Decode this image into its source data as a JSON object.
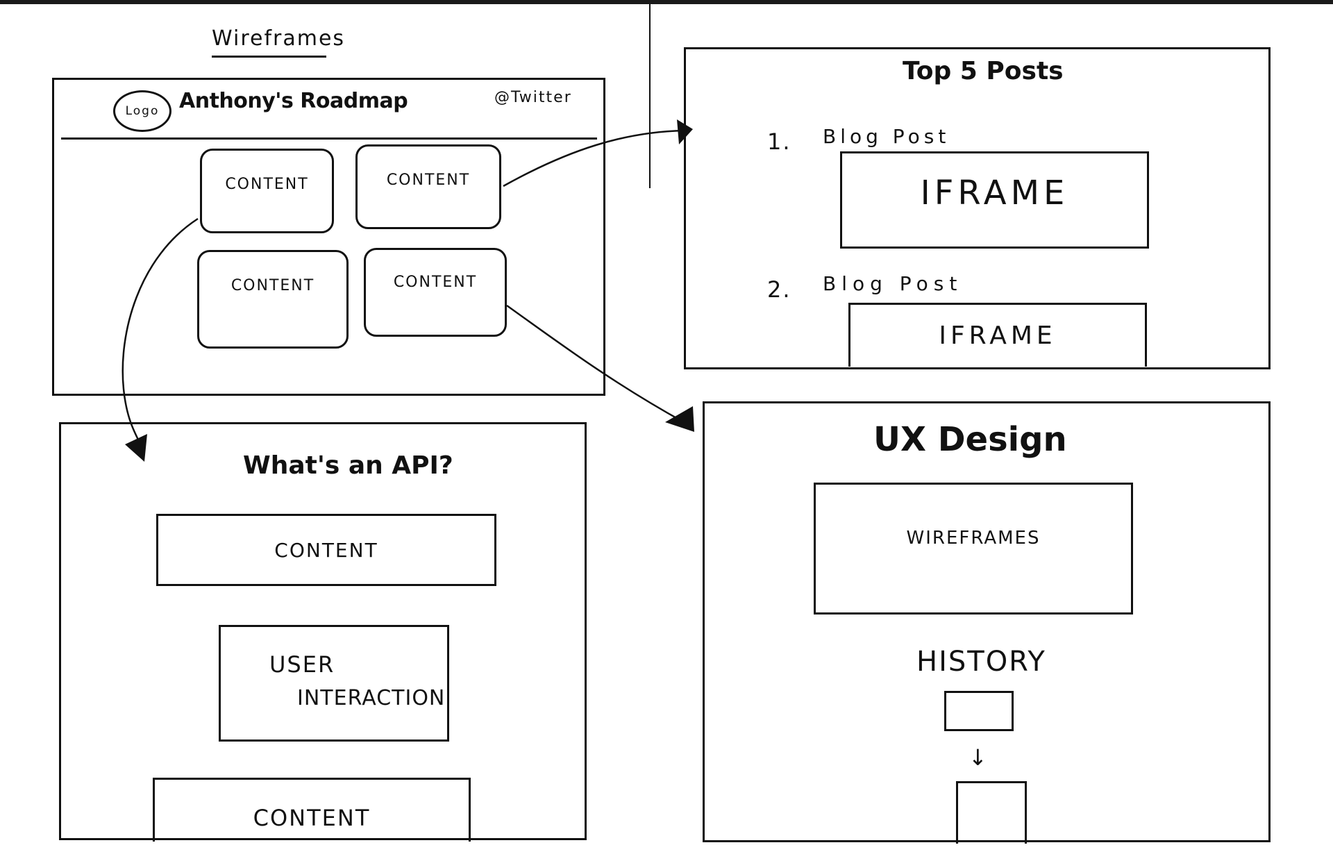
{
  "sheet": {
    "title": "Wireframes"
  },
  "homepage": {
    "logo_label": "Logo",
    "site_title": "Anthony's Roadmap",
    "social_link": "@Twitter",
    "cards": [
      {
        "label": "CONTENT",
        "links_to": "Top 5 Posts"
      },
      {
        "label": "CONTENT",
        "links_to": "What's an API?"
      },
      {
        "label": "CONTENT"
      },
      {
        "label": "CONTENT",
        "links_to": "UX Design"
      }
    ]
  },
  "top_posts_page": {
    "heading": "Top 5 Posts",
    "posts": [
      {
        "number": "1.",
        "title": "Blog Post",
        "embed_label": "IFRAME"
      },
      {
        "number": "2.",
        "title": "Blog Post",
        "embed_label": "IFRAME"
      }
    ]
  },
  "api_page": {
    "heading": "What's an API?",
    "blocks": [
      {
        "label": "CONTENT"
      },
      {
        "label": "USER INTERACTION",
        "line1": "USER",
        "line2": "INTERACTION"
      },
      {
        "label": "CONTENT"
      }
    ]
  },
  "ux_page": {
    "heading": "UX Design",
    "wireframes_label": "WIREFRAMES",
    "history_label": "HISTORY",
    "history_arrow": "↓"
  }
}
